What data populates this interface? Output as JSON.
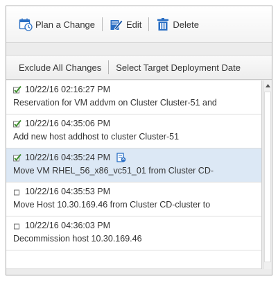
{
  "toolbar": {
    "plan_label": "Plan a Change",
    "edit_label": "Edit",
    "delete_label": "Delete",
    "plan_icon": "calendar-clock-icon",
    "edit_icon": "pencil-icon",
    "delete_icon": "trash-icon"
  },
  "actions": {
    "exclude_label": "Exclude All Changes",
    "select_date_label": "Select Target Deployment Date"
  },
  "changes": [
    {
      "timestamp": "10/22/16 02:16:27 PM",
      "description": "Reservation for VM addvm on Cluster Cluster-51 and",
      "status_icon": "green-check-icon",
      "selected": false
    },
    {
      "timestamp": "10/22/16 04:35:06 PM",
      "description": "Add new host addhost to cluster Cluster-51",
      "status_icon": "green-check-icon",
      "selected": false
    },
    {
      "timestamp": "10/22/16 04:35:24 PM",
      "description": "Move VM RHEL_56_x86_vc51_01 from Cluster CD-",
      "status_icon": "green-check-icon",
      "selected": true,
      "attachment_icon": "edit-document-icon"
    },
    {
      "timestamp": "10/22/16 04:35:53 PM",
      "description": "Move Host 10.30.169.46 from Cluster CD-cluster to",
      "status_icon": "unchecked-box-icon",
      "selected": false
    },
    {
      "timestamp": "10/22/16 04:36:03 PM",
      "description": "Decommission host 10.30.169.46",
      "status_icon": "unchecked-box-icon",
      "selected": false
    }
  ],
  "colors": {
    "selected_row": "#dce8f5",
    "check_green": "#3f8f2f",
    "icon_blue": "#2a6fc4"
  }
}
